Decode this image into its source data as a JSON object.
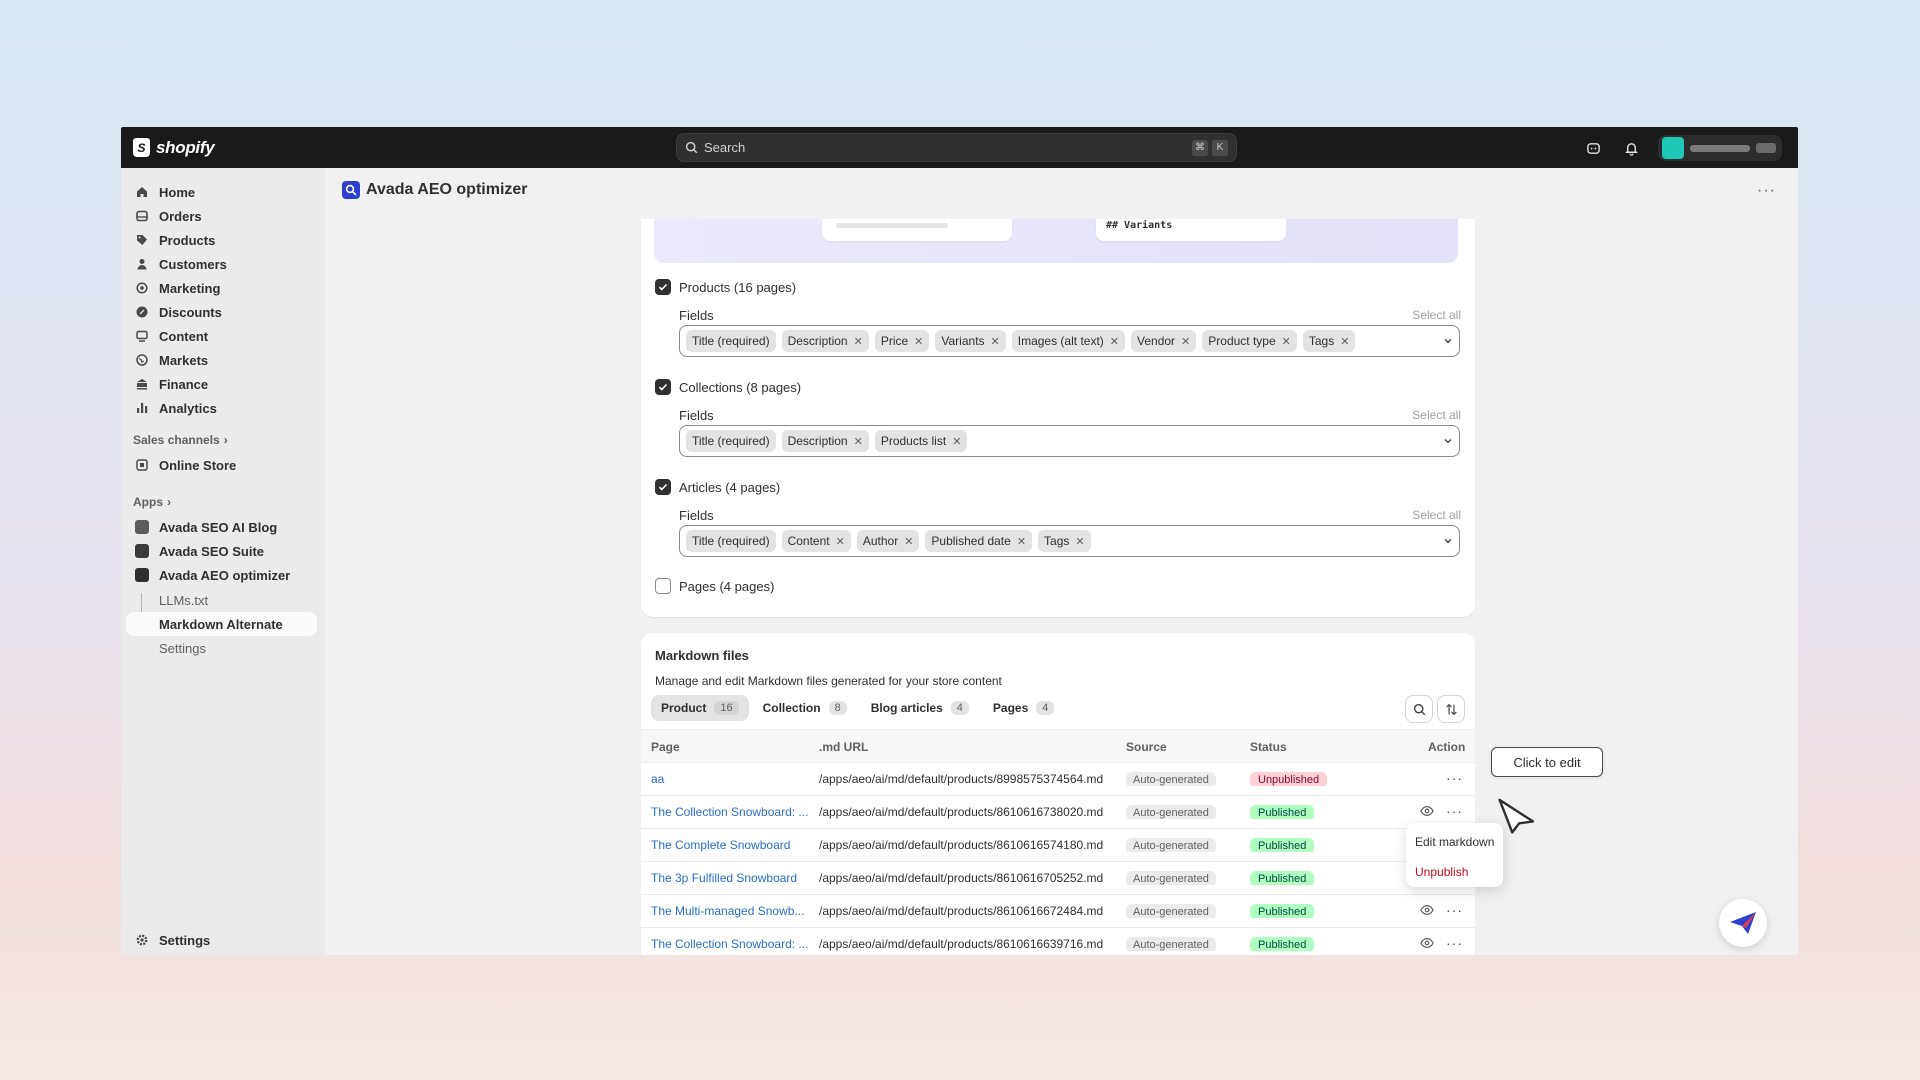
{
  "topbar": {
    "logo_text": "shopify",
    "logo_mark": "S",
    "search_placeholder": "Search",
    "shortcut": [
      "⌘",
      "K"
    ]
  },
  "sidebar": {
    "main_items": [
      {
        "label": "Home",
        "icon": "home-icon"
      },
      {
        "label": "Orders",
        "icon": "orders-icon"
      },
      {
        "label": "Products",
        "icon": "tag-icon"
      },
      {
        "label": "Customers",
        "icon": "person-icon"
      },
      {
        "label": "Marketing",
        "icon": "target-icon"
      },
      {
        "label": "Discounts",
        "icon": "discount-icon"
      },
      {
        "label": "Content",
        "icon": "content-icon"
      },
      {
        "label": "Markets",
        "icon": "globe-icon"
      },
      {
        "label": "Finance",
        "icon": "bank-icon"
      },
      {
        "label": "Analytics",
        "icon": "bar-chart-icon"
      }
    ],
    "sales_channels_label": "Sales channels",
    "online_store": "Online Store",
    "apps_label": "Apps",
    "apps": [
      "Avada SEO AI Blog",
      "Avada SEO Suite",
      "Avada AEO optimizer"
    ],
    "sub_items": [
      "LLMs.txt",
      "Markdown Alternate",
      "Settings"
    ],
    "settings": "Settings"
  },
  "page": {
    "title": "Avada AEO optimizer",
    "more": "···"
  },
  "preview": {
    "variants_text": "## Variants"
  },
  "sections": [
    {
      "label": "Products (16 pages)",
      "checked": true,
      "fields_label": "Fields",
      "select_all": "Select all",
      "tags": [
        "Title (required)",
        "Description",
        "Price",
        "Variants",
        "Images (alt text)",
        "Vendor",
        "Product type",
        "Tags"
      ]
    },
    {
      "label": "Collections (8 pages)",
      "checked": true,
      "fields_label": "Fields",
      "select_all": "Select all",
      "tags": [
        "Title (required)",
        "Description",
        "Products list"
      ]
    },
    {
      "label": "Articles (4 pages)",
      "checked": true,
      "fields_label": "Fields",
      "select_all": "Select all",
      "tags": [
        "Title (required)",
        "Content",
        "Author",
        "Published date",
        "Tags"
      ]
    },
    {
      "label": "Pages (4 pages)",
      "checked": false
    }
  ],
  "markdown": {
    "title": "Markdown files",
    "subtitle": "Manage and edit Markdown files generated for your store content",
    "tabs": [
      {
        "label": "Product",
        "count": "16"
      },
      {
        "label": "Collection",
        "count": "8"
      },
      {
        "label": "Blog articles",
        "count": "4"
      },
      {
        "label": "Pages",
        "count": "4"
      }
    ],
    "columns": [
      "Page",
      ".md URL",
      "Source",
      "Status",
      "Action"
    ],
    "rows": [
      {
        "page": "aa",
        "url": "/apps/aeo/ai/md/default/products/8998575374564.md",
        "source": "Auto-generated",
        "status": "Unpublished"
      },
      {
        "page": "The Collection Snowboard: ...",
        "url": "/apps/aeo/ai/md/default/products/8610616738020.md",
        "source": "Auto-generated",
        "status": "Published"
      },
      {
        "page": "The Complete Snowboard",
        "url": "/apps/aeo/ai/md/default/products/8610616574180.md",
        "source": "Auto-generated",
        "status": "Published"
      },
      {
        "page": "The 3p Fulfilled Snowboard",
        "url": "/apps/aeo/ai/md/default/products/8610616705252.md",
        "source": "Auto-generated",
        "status": "Published"
      },
      {
        "page": "The Multi-managed Snowb...",
        "url": "/apps/aeo/ai/md/default/products/8610616672484.md",
        "source": "Auto-generated",
        "status": "Published"
      },
      {
        "page": "The Collection Snowboard: ...",
        "url": "/apps/aeo/ai/md/default/products/8610616639716.md",
        "source": "Auto-generated",
        "status": "Published"
      }
    ]
  },
  "popover": {
    "edit": "Edit markdown",
    "unpublish": "Unpublish"
  },
  "tooltip": "Click to edit",
  "colors": {
    "topbar": "#1a1a1a",
    "link": "#2c6ecb",
    "published_bg": "#affebf",
    "unpublished_bg": "#fed1d7",
    "danger": "#c70a24"
  }
}
